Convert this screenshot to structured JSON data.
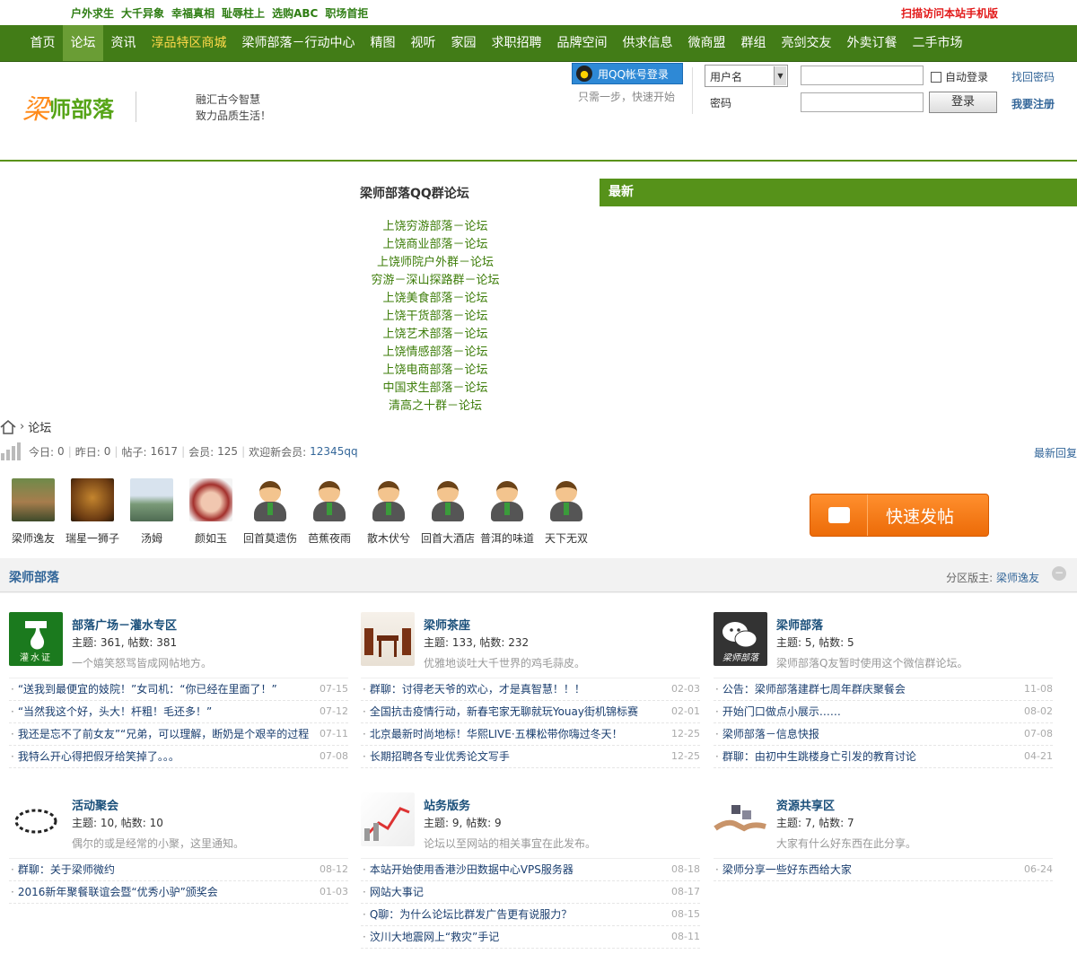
{
  "topbar": {
    "links": [
      "户外求生",
      "大千异象",
      "幸福真相",
      "耻辱柱上",
      "选购ABC",
      "职场首拒"
    ],
    "mobile": "扫描访问本站手机版"
  },
  "nav": {
    "items": [
      "首页",
      "论坛",
      "资讯",
      "淳品特区商城",
      "梁师部落－行动中心",
      "精图",
      "视听",
      "家园",
      "求职招聘",
      "品牌空间",
      "供求信息",
      "微商盟",
      "群组",
      "亮剑交友",
      "外卖订餐",
      "二手市场"
    ],
    "active_index": 1
  },
  "header": {
    "logo_mark": "梁",
    "logo_name": "师部落",
    "slogan1": "融汇古今智慧",
    "slogan2": "致力品质生活！",
    "qq_login": "用QQ帐号登录",
    "qq_tip": "只需一步，快速开始",
    "user_select": "用户名",
    "password_label": "密码",
    "auto_login": "自动登录",
    "login_button": "登录",
    "find_password": "找回密码",
    "register": "我要注册"
  },
  "qq_groups": {
    "title": "梁师部落QQ群论坛",
    "items": [
      "上饶穷游部落－论坛",
      "上饶商业部落－论坛",
      "上饶师院户外群－论坛",
      "穷游－深山探路群－论坛",
      "上饶美食部落－论坛",
      "上饶干货部落－论坛",
      "上饶艺术部落－论坛",
      "上饶情感部落－论坛",
      "上饶电商部落－论坛",
      "中国求生部落－论坛",
      "清高之十群－论坛"
    ]
  },
  "newest": "最新",
  "breadcrumb": "论坛",
  "stats": {
    "today_label": "今日: ",
    "today": "0",
    "yesterday_label": "昨日: ",
    "yesterday": "0",
    "posts_label": "帖子: ",
    "posts": "1617",
    "members_label": "会员: ",
    "members": "125",
    "newmember_label": "欢迎新会员: ",
    "newmember": "12345qq",
    "latest_reply": "最新回复"
  },
  "members": [
    "梁师逸友",
    "瑞星一狮子",
    "汤姆",
    "颜如玉",
    "回首莫遗伤",
    "芭蕉夜雨",
    "散木伏兮",
    "回首大酒店",
    "普洱的味道",
    "天下无双"
  ],
  "quick_post": "快速发帖",
  "section": {
    "title": "梁师部落",
    "moderator_label": "分区版主: ",
    "moderator": "梁师逸友",
    "collapse": "−"
  },
  "forums": [
    {
      "name": "部落广场－灌水专区",
      "stat": "主题: 361, 帖数: 381",
      "desc": "一个嬉笑怒骂皆成网帖地方。",
      "icon": "water-icon",
      "threads": [
        [
          "“送我到最便宜的妓院！”女司机：“你已经在里面了！”",
          "07-15"
        ],
        [
          "“当然我这个好，头大！杆粗！毛还多！”",
          "07-12"
        ],
        [
          "我还是忘不了前女友”“兄弟，可以理解，断奶是个艰辛的过程",
          "07-11"
        ],
        [
          "我特么开心得把假牙给笑掉了。。。",
          "07-08"
        ]
      ]
    },
    {
      "name": "梁师茶座",
      "stat": "主题: 133, 帖数: 232",
      "desc": "优雅地谈吐大千世界的鸡毛蒜皮。",
      "icon": "tea-icon",
      "threads": [
        [
          "群聊：讨得老天爷的欢心，才是真智慧！！！",
          "02-03"
        ],
        [
          "全国抗击疫情行动，新春宅家无聊就玩Youay街机锦标赛",
          "02-01"
        ],
        [
          "北京最新时尚地标！华熙LIVE·五棵松带你嗨过冬天！",
          "12-25"
        ],
        [
          "长期招聘各专业优秀论文写手",
          "12-25"
        ]
      ]
    },
    {
      "name": "梁师部落",
      "stat": "主题: 5, 帖数: 5",
      "desc": "梁师部落Q友暂时使用这个微信群论坛。",
      "icon": "wechat-icon",
      "threads": [
        [
          "公告：梁师部落建群七周年群庆聚餐会",
          "11-08"
        ],
        [
          "开始门口做点小展示……",
          "08-02"
        ],
        [
          "梁师部落－信息快报",
          "07-08"
        ],
        [
          "群聊：由初中生跳楼身亡引发的教育讨论",
          "04-21"
        ]
      ]
    },
    {
      "name": "活动聚会",
      "stat": "主题: 10, 帖数: 10",
      "desc": "偶尔的或是经常的小聚，这里通知。",
      "icon": "activity-icon",
      "threads": [
        [
          "群聊：关于梁师微约",
          "08-12"
        ],
        [
          "2016新年聚餐联谊会暨“优秀小驴”颁奖会",
          "01-03"
        ]
      ]
    },
    {
      "name": "站务版务",
      "stat": "主题: 9, 帖数: 9",
      "desc": "论坛以至网站的相关事宜在此发布。",
      "icon": "affairs-icon",
      "threads": [
        [
          "本站开始使用香港沙田数据中心VPS服务器",
          "08-18"
        ],
        [
          "网站大事记",
          "08-17"
        ],
        [
          "Q聊：为什么论坛比群发广告更有说服力？",
          "08-15"
        ],
        [
          "汶川大地震网上“救灾”手记",
          "08-11"
        ]
      ]
    },
    {
      "name": "资源共享区",
      "stat": "主题: 7, 帖数: 7",
      "desc": "大家有什么好东西在此分享。",
      "icon": "share-icon",
      "threads": [
        [
          "梁师分享一些好东西给大家",
          "06-24"
        ]
      ]
    }
  ],
  "wechat_icon_text": "梁师部落",
  "water_icon_text": "灌水证"
}
